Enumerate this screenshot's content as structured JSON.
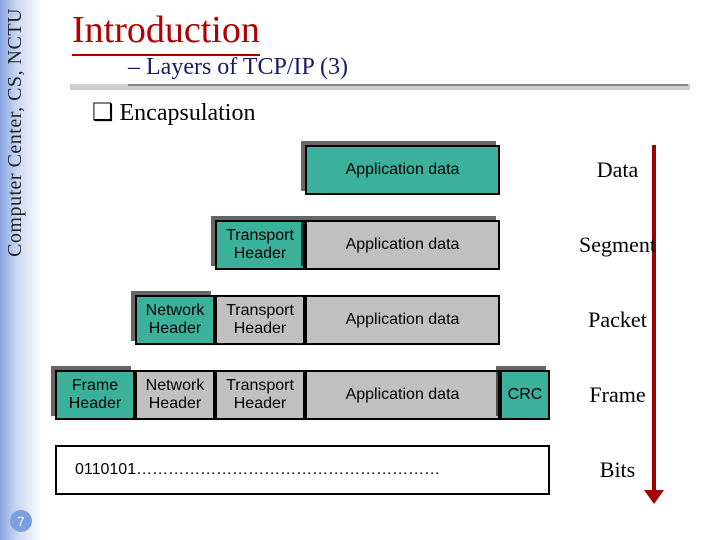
{
  "sidebar": {
    "org": "Computer Center, CS, NCTU"
  },
  "title": "Introduction",
  "subtitle": "– Layers of TCP/IP (3)",
  "bullet": "Encapsulation",
  "pagenum": "7",
  "labels": {
    "data": "Data",
    "segment": "Segment",
    "packet": "Packet",
    "frame": "Frame",
    "bits": "Bits"
  },
  "blocks": {
    "app_data": "Application data",
    "transport_hdr": "Transport\nHeader",
    "network_hdr": "Network\nHeader",
    "frame_hdr": "Frame\nHeader",
    "crc": "CRC"
  },
  "bits_stream": "0110101…………………………………………………",
  "chart_data": {
    "type": "table",
    "title": "TCP/IP Encapsulation layers",
    "rows": [
      {
        "layer_pdu": "Data",
        "fields": [
          "Application data"
        ]
      },
      {
        "layer_pdu": "Segment",
        "fields": [
          "Transport Header",
          "Application data"
        ]
      },
      {
        "layer_pdu": "Packet",
        "fields": [
          "Network Header",
          "Transport Header",
          "Application data"
        ]
      },
      {
        "layer_pdu": "Frame",
        "fields": [
          "Frame Header",
          "Network Header",
          "Transport Header",
          "Application data",
          "CRC"
        ]
      },
      {
        "layer_pdu": "Bits",
        "fields": [
          "0110101…"
        ]
      }
    ]
  }
}
